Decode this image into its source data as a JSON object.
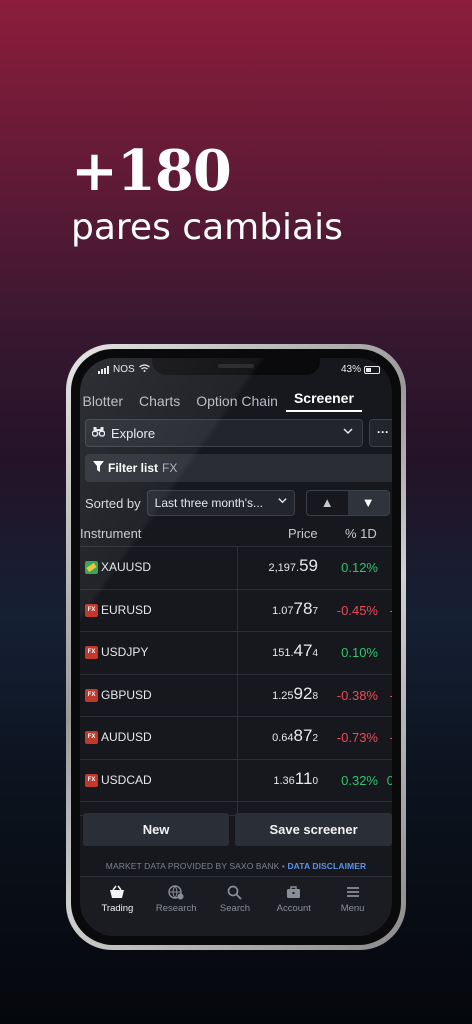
{
  "promo": {
    "headline": "+180",
    "subheadline": "pares cambiais"
  },
  "status_bar": {
    "carrier": "NOS",
    "battery": "43%",
    "battery_level": 0.43
  },
  "tabs": [
    {
      "label": "r Blotter"
    },
    {
      "label": "Charts"
    },
    {
      "label": "Option Chain"
    },
    {
      "label": "Screener",
      "active": true
    }
  ],
  "explore": {
    "label": "Explore"
  },
  "filter": {
    "label": "Filter list",
    "value": "FX"
  },
  "sort": {
    "label": "Sorted by",
    "selected": "Last three month's..."
  },
  "table": {
    "headers": {
      "instrument": "Instrument",
      "price": "Price",
      "change": "% 1D"
    },
    "rows": [
      {
        "badge": "",
        "badge_color": "#2fa04a",
        "name": "XAUUSD",
        "price_small": "2,197.",
        "price_big": "59",
        "price_sup": "",
        "change": "0.12%",
        "dir": "pos",
        "tail": ""
      },
      {
        "badge": "FX",
        "badge_color": "#c0392b",
        "name": "EURUSD",
        "price_small": "1.07",
        "price_big": "78",
        "price_sup": "7",
        "change": "-0.45%",
        "dir": "neg",
        "tail": "-"
      },
      {
        "badge": "FX",
        "badge_color": "#c0392b",
        "name": "USDJPY",
        "price_small": "151.",
        "price_big": "47",
        "price_sup": "4",
        "change": "0.10%",
        "dir": "pos",
        "tail": ""
      },
      {
        "badge": "FX",
        "badge_color": "#c0392b",
        "name": "GBPUSD",
        "price_small": "1.25",
        "price_big": "92",
        "price_sup": "8",
        "change": "-0.38%",
        "dir": "neg",
        "tail": "-"
      },
      {
        "badge": "FX",
        "badge_color": "#c0392b",
        "name": "AUDUSD",
        "price_small": "0.64",
        "price_big": "87",
        "price_sup": "2",
        "change": "-0.73%",
        "dir": "neg",
        "tail": "-"
      },
      {
        "badge": "FX",
        "badge_color": "#c0392b",
        "name": "USDCAD",
        "price_small": "1.36",
        "price_big": "11",
        "price_sup": "0",
        "change": "0.32%",
        "dir": "pos",
        "tail": "0"
      }
    ]
  },
  "buttons": {
    "new": "New",
    "save": "Save screener"
  },
  "disclaimer": {
    "text": "MARKET DATA PROVIDED BY SAXO BANK •",
    "link": "DATA DISCLAIMER"
  },
  "nav": [
    {
      "label": "Trading",
      "icon": "basket-icon",
      "active": true
    },
    {
      "label": "Research",
      "icon": "globe-star-icon"
    },
    {
      "label": "Search",
      "icon": "search-icon"
    },
    {
      "label": "Account",
      "icon": "briefcase-icon"
    },
    {
      "label": "Menu",
      "icon": "hamburger-icon"
    }
  ],
  "colors": {
    "positive": "#33c26b",
    "negative": "#ef4a56",
    "link": "#5a93e6"
  }
}
